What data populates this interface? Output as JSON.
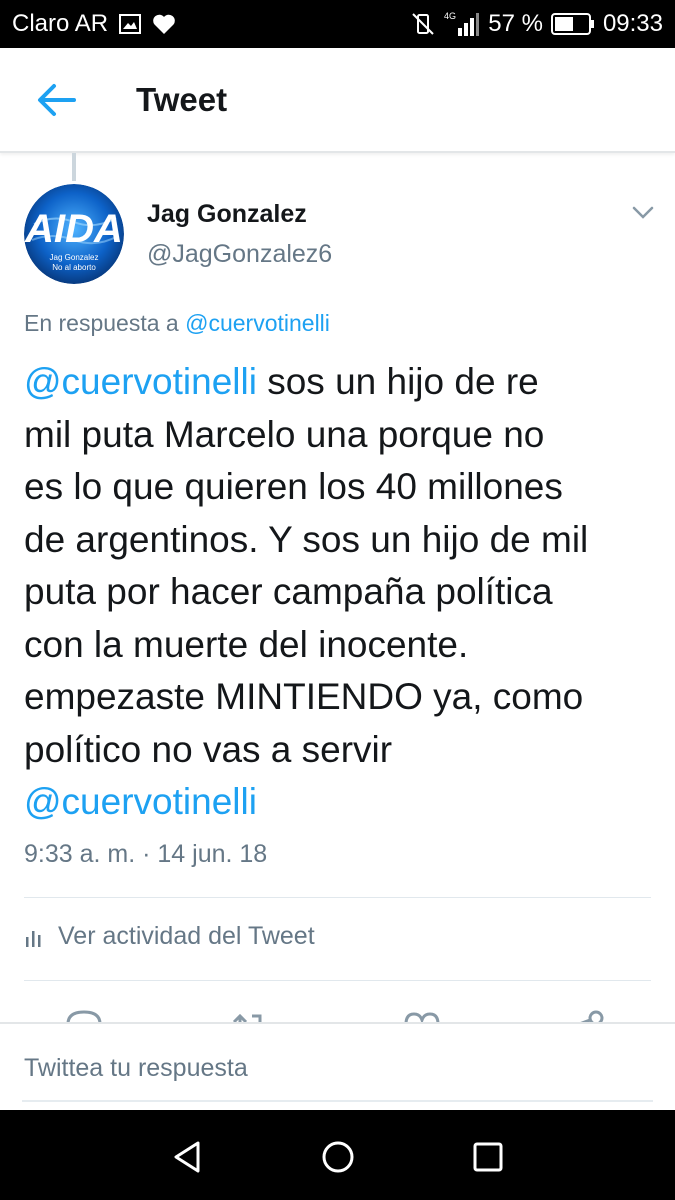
{
  "status_bar": {
    "carrier": "Claro AR",
    "network": "4G",
    "battery_percent": "57 %",
    "battery_level": 0.57,
    "time": "09:33"
  },
  "app_bar": {
    "title": "Tweet",
    "back_icon": "arrow-left-icon"
  },
  "tweet": {
    "author": {
      "name": "Jag Gonzalez",
      "handle": "@JagGonzalez6",
      "avatar_text": "AIDA",
      "avatar_caption_1": "Jag Gonzalez",
      "avatar_caption_2": "No al aborto"
    },
    "reply_to_prefix": "En respuesta a",
    "reply_to_handle": "@cuervotinelli",
    "text": {
      "mention_start": "@cuervotinelli",
      "line1_rest": " sos un hijo de re",
      "line2": "mil puta Marcelo una porque no",
      "line3": "es lo que quieren los 40 millones",
      "line4": "de argentinos. Y sos un hijo de mil",
      "line5": "puta por hacer campaña política",
      "line6": "con la muerte del inocente.",
      "line7": "empezaste MINTIENDO ya, como",
      "line8": "político no vas a servir",
      "mention_end": "@cuervotinelli"
    },
    "timestamp": "9:33 a. m. · 14 jun. 18",
    "activity_label": "Ver actividad del Tweet"
  },
  "reply_composer": {
    "placeholder": "Twittea tu respuesta"
  },
  "colors": {
    "accent": "#1da1f2",
    "text_primary": "#14171a",
    "text_secondary": "#657786",
    "divider": "#e1e8ed"
  }
}
